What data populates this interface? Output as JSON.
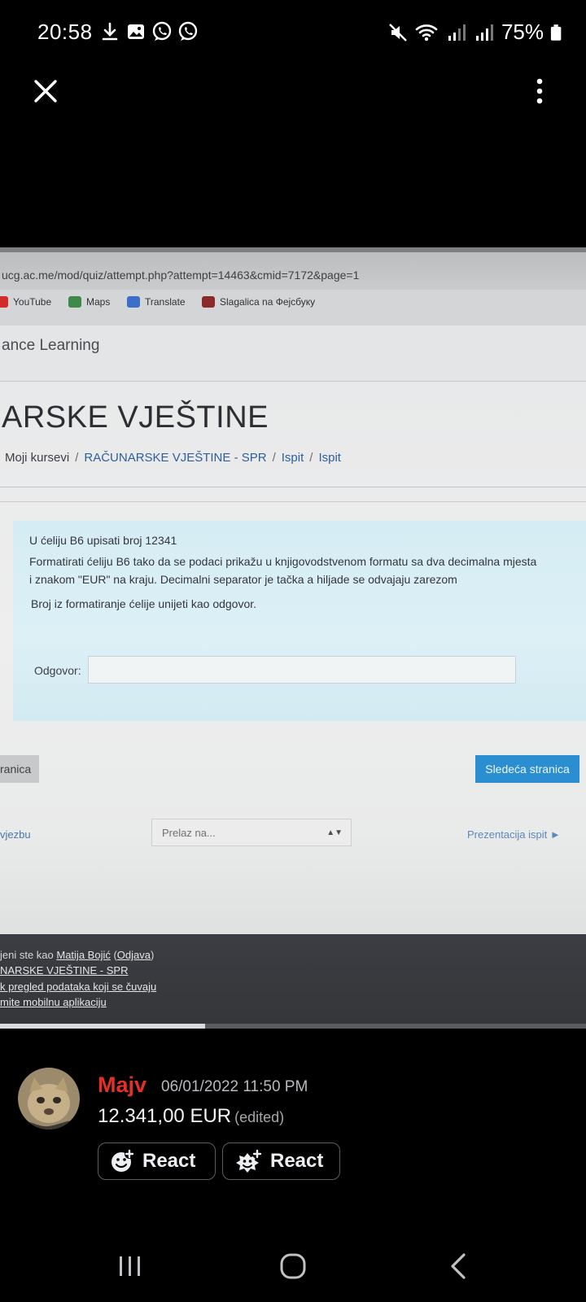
{
  "status_bar": {
    "time": "20:58",
    "battery": "75%"
  },
  "photo": {
    "url": "ucg.ac.me/mod/quiz/attempt.php?attempt=14463&cmid=7172&page=1",
    "bookmarks": [
      {
        "label": "YouTube",
        "color": "#d22b2b"
      },
      {
        "label": "Maps",
        "color": "#3f8a4a"
      },
      {
        "label": "Translate",
        "color": "#3b6fc8"
      },
      {
        "label": "Slagalica na Фејсбуку",
        "color": "#8b2a2a"
      }
    ],
    "site_name": "ance Learning",
    "course_title": "ARSKE VJEŠTINE",
    "breadcrumb": [
      "Moji kursevi",
      "RAČUNARSKE VJEŠTINE - SPR",
      "Ispit",
      "Ispit"
    ],
    "question_lines": [
      "U ćeliju B6 upisati broj 12341",
      "Formatirati ćeliju B6 tako da se podaci prikažu u knjigovodstvenom formatu sa dva decimalna mjesta",
      "i znakom \"EUR\" na kraju. Decimalni separator je tačka a hiljade se odvajaju zarezom",
      "Broj iz formatiranje ćelije unijeti kao odgovor."
    ],
    "answer_label": "Odgovor:",
    "answer_value": "",
    "prev_button": "ranica",
    "next_button": "Sledeća stranica",
    "prev_link": "vjezbu",
    "jump_select": "Prelaz na...",
    "next_link": "Prezentacija ispit ►",
    "footer": {
      "logged_in_prefix": "jeni ste kao ",
      "user_name": "Matija Bojić",
      "logout_open": " (",
      "logout": "Odjava",
      "logout_close": ")",
      "course_link": "NARSKE VJEŠTINE - SPR",
      "data_link": "k pregled podataka koji se čuvaju",
      "app_link": "mite mobilnu aplikaciju"
    }
  },
  "message": {
    "author": "Majv",
    "timestamp": "06/01/2022 11:50 PM",
    "text": "12.341,00 EUR",
    "edited": "(edited)",
    "react_buttons": [
      "React",
      "React"
    ]
  },
  "colors": {
    "author": "#e5302a",
    "next_button": "#2a8ed0",
    "background": "#000000"
  }
}
